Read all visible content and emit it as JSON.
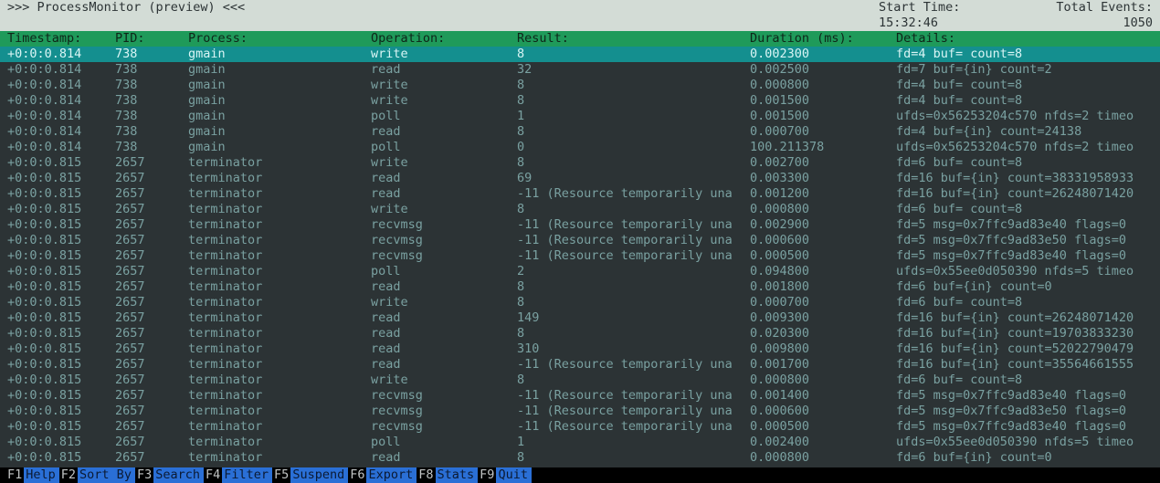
{
  "title": ">>> ProcessMonitor (preview) <<<",
  "start_time_label": "Start Time:",
  "start_time_value": "15:32:46",
  "total_events_label": "Total Events:",
  "total_events_value": "1050",
  "columns": {
    "timestamp": "Timestamp:",
    "pid": "PID:",
    "process": "Process:",
    "operation": "Operation:",
    "result": "Result:",
    "duration": "Duration (ms):",
    "details": "Details:"
  },
  "rows": [
    {
      "ts": "+0:0:0.814",
      "pid": "738",
      "proc": "gmain",
      "op": "write",
      "res": "8",
      "dur": "0.002300",
      "det": "fd=4  buf=   count=8",
      "sel": true
    },
    {
      "ts": "+0:0:0.814",
      "pid": "738",
      "proc": "gmain",
      "op": "read",
      "res": "32",
      "dur": "0.002500",
      "det": "fd=7  buf={in}  count=2"
    },
    {
      "ts": "+0:0:0.814",
      "pid": "738",
      "proc": "gmain",
      "op": "write",
      "res": "8",
      "dur": "0.000800",
      "det": "fd=4  buf=   count=8"
    },
    {
      "ts": "+0:0:0.814",
      "pid": "738",
      "proc": "gmain",
      "op": "write",
      "res": "8",
      "dur": "0.001500",
      "det": "fd=4  buf=   count=8"
    },
    {
      "ts": "+0:0:0.814",
      "pid": "738",
      "proc": "gmain",
      "op": "poll",
      "res": "1",
      "dur": "0.001500",
      "det": "ufds=0x56253204c570  nfds=2  timeo"
    },
    {
      "ts": "+0:0:0.814",
      "pid": "738",
      "proc": "gmain",
      "op": "read",
      "res": "8",
      "dur": "0.000700",
      "det": "fd=4  buf={in}  count=24138"
    },
    {
      "ts": "+0:0:0.814",
      "pid": "738",
      "proc": "gmain",
      "op": "poll",
      "res": "0",
      "dur": "100.211378",
      "det": "ufds=0x56253204c570  nfds=2  timeo"
    },
    {
      "ts": "+0:0:0.815",
      "pid": "2657",
      "proc": "terminator",
      "op": "write",
      "res": "8",
      "dur": "0.002700",
      "det": "fd=6  buf=   count=8"
    },
    {
      "ts": "+0:0:0.815",
      "pid": "2657",
      "proc": "terminator",
      "op": "read",
      "res": "69",
      "dur": "0.003300",
      "det": "fd=16  buf={in}  count=38331958933"
    },
    {
      "ts": "+0:0:0.815",
      "pid": "2657",
      "proc": "terminator",
      "op": "read",
      "res": "-11 (Resource temporarily una",
      "dur": "0.001200",
      "det": "fd=16  buf={in}  count=26248071420"
    },
    {
      "ts": "+0:0:0.815",
      "pid": "2657",
      "proc": "terminator",
      "op": "write",
      "res": "8",
      "dur": "0.000800",
      "det": "fd=6  buf=   count=8"
    },
    {
      "ts": "+0:0:0.815",
      "pid": "2657",
      "proc": "terminator",
      "op": "recvmsg",
      "res": "-11 (Resource temporarily una",
      "dur": "0.002900",
      "det": "fd=5  msg=0x7ffc9ad83e40  flags=0"
    },
    {
      "ts": "+0:0:0.815",
      "pid": "2657",
      "proc": "terminator",
      "op": "recvmsg",
      "res": "-11 (Resource temporarily una",
      "dur": "0.000600",
      "det": "fd=5  msg=0x7ffc9ad83e50  flags=0"
    },
    {
      "ts": "+0:0:0.815",
      "pid": "2657",
      "proc": "terminator",
      "op": "recvmsg",
      "res": "-11 (Resource temporarily una",
      "dur": "0.000500",
      "det": "fd=5  msg=0x7ffc9ad83e40  flags=0"
    },
    {
      "ts": "+0:0:0.815",
      "pid": "2657",
      "proc": "terminator",
      "op": "poll",
      "res": "2",
      "dur": "0.094800",
      "det": "ufds=0x55ee0d050390  nfds=5  timeo"
    },
    {
      "ts": "+0:0:0.815",
      "pid": "2657",
      "proc": "terminator",
      "op": "read",
      "res": "8",
      "dur": "0.001800",
      "det": "fd=6  buf={in}  count=0"
    },
    {
      "ts": "+0:0:0.815",
      "pid": "2657",
      "proc": "terminator",
      "op": "write",
      "res": "8",
      "dur": "0.000700",
      "det": "fd=6  buf=   count=8"
    },
    {
      "ts": "+0:0:0.815",
      "pid": "2657",
      "proc": "terminator",
      "op": "read",
      "res": "149",
      "dur": "0.009300",
      "det": "fd=16  buf={in}  count=26248071420"
    },
    {
      "ts": "+0:0:0.815",
      "pid": "2657",
      "proc": "terminator",
      "op": "read",
      "res": "8",
      "dur": "0.020300",
      "det": "fd=16  buf={in}  count=19703833230"
    },
    {
      "ts": "+0:0:0.815",
      "pid": "2657",
      "proc": "terminator",
      "op": "read",
      "res": "310",
      "dur": "0.009800",
      "det": "fd=16  buf={in}  count=52022790479"
    },
    {
      "ts": "+0:0:0.815",
      "pid": "2657",
      "proc": "terminator",
      "op": "read",
      "res": "-11 (Resource temporarily una",
      "dur": "0.001700",
      "det": "fd=16  buf={in}  count=35564661555"
    },
    {
      "ts": "+0:0:0.815",
      "pid": "2657",
      "proc": "terminator",
      "op": "write",
      "res": "8",
      "dur": "0.000800",
      "det": "fd=6  buf=   count=8"
    },
    {
      "ts": "+0:0:0.815",
      "pid": "2657",
      "proc": "terminator",
      "op": "recvmsg",
      "res": "-11 (Resource temporarily una",
      "dur": "0.001400",
      "det": "fd=5  msg=0x7ffc9ad83e40  flags=0"
    },
    {
      "ts": "+0:0:0.815",
      "pid": "2657",
      "proc": "terminator",
      "op": "recvmsg",
      "res": "-11 (Resource temporarily una",
      "dur": "0.000600",
      "det": "fd=5  msg=0x7ffc9ad83e50  flags=0"
    },
    {
      "ts": "+0:0:0.815",
      "pid": "2657",
      "proc": "terminator",
      "op": "recvmsg",
      "res": "-11 (Resource temporarily una",
      "dur": "0.000500",
      "det": "fd=5  msg=0x7ffc9ad83e40  flags=0"
    },
    {
      "ts": "+0:0:0.815",
      "pid": "2657",
      "proc": "terminator",
      "op": "poll",
      "res": "1",
      "dur": "0.002400",
      "det": "ufds=0x55ee0d050390  nfds=5  timeo"
    },
    {
      "ts": "+0:0:0.815",
      "pid": "2657",
      "proc": "terminator",
      "op": "read",
      "res": "8",
      "dur": "0.000800",
      "det": "fd=6  buf={in}  count=0"
    }
  ],
  "footer": [
    {
      "key": "F1",
      "label": "Help"
    },
    {
      "key": "F2",
      "label": "Sort By"
    },
    {
      "key": "F3",
      "label": "Search"
    },
    {
      "key": "F4",
      "label": "Filter"
    },
    {
      "key": "F5",
      "label": "Suspend"
    },
    {
      "key": "F6",
      "label": "Export"
    },
    {
      "key": "F8",
      "label": "Stats"
    },
    {
      "key": "F9",
      "label": "Quit"
    }
  ]
}
